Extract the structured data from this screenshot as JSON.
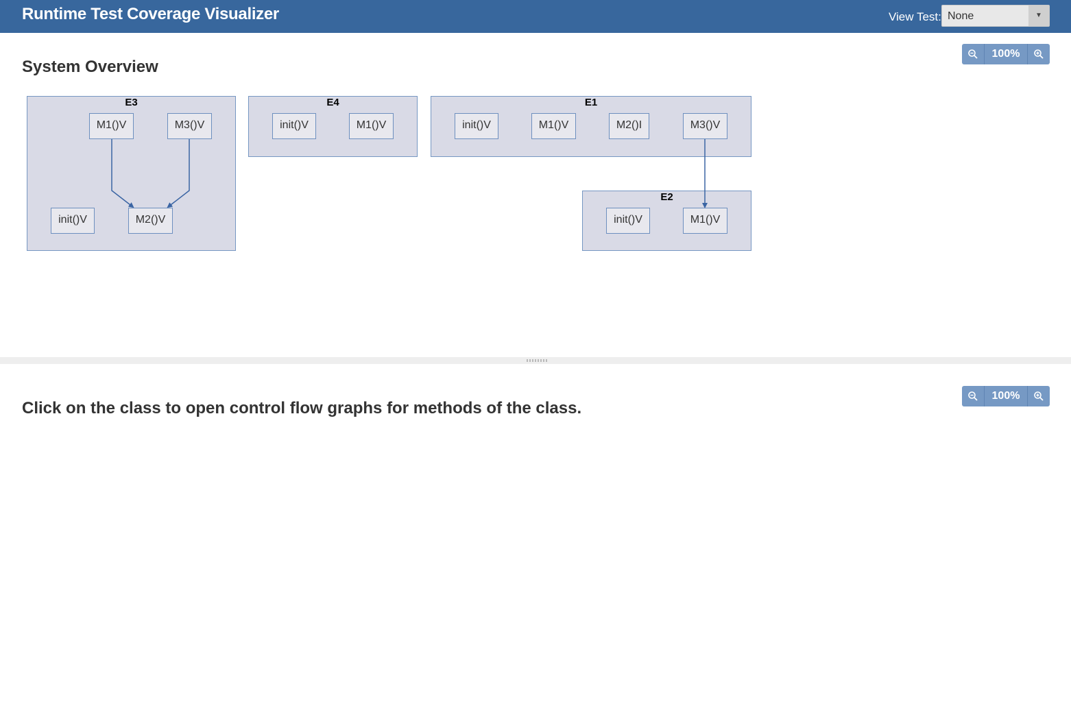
{
  "header": {
    "title": "Runtime Test Coverage Visualizer",
    "view_test_label": "View Test:",
    "view_test_value": "None"
  },
  "overview": {
    "title": "System Overview",
    "zoom": "100%"
  },
  "detail": {
    "title": "Click on the class to open control flow graphs for methods of the class.",
    "zoom": "100%"
  },
  "graph": {
    "classes": [
      {
        "id": "E3",
        "label": "E3",
        "methods": [
          "M1()V",
          "M3()V",
          "init()V",
          "M2()V"
        ]
      },
      {
        "id": "E4",
        "label": "E4",
        "methods": [
          "init()V",
          "M1()V"
        ]
      },
      {
        "id": "E1",
        "label": "E1",
        "methods": [
          "init()V",
          "M1()V",
          "M2()I",
          "M3()V"
        ]
      },
      {
        "id": "E2",
        "label": "E2",
        "methods": [
          "init()V",
          "M1()V"
        ]
      }
    ],
    "edges": [
      {
        "from": "E3.M1()V",
        "to": "E3.M2()V"
      },
      {
        "from": "E3.M3()V",
        "to": "E3.M2()V"
      },
      {
        "from": "E1.M3()V",
        "to": "E2.M1()V"
      }
    ],
    "colors": {
      "class_fill": "#d9dae6",
      "class_border": "#7596c2",
      "edge": "#3a64a3"
    }
  }
}
